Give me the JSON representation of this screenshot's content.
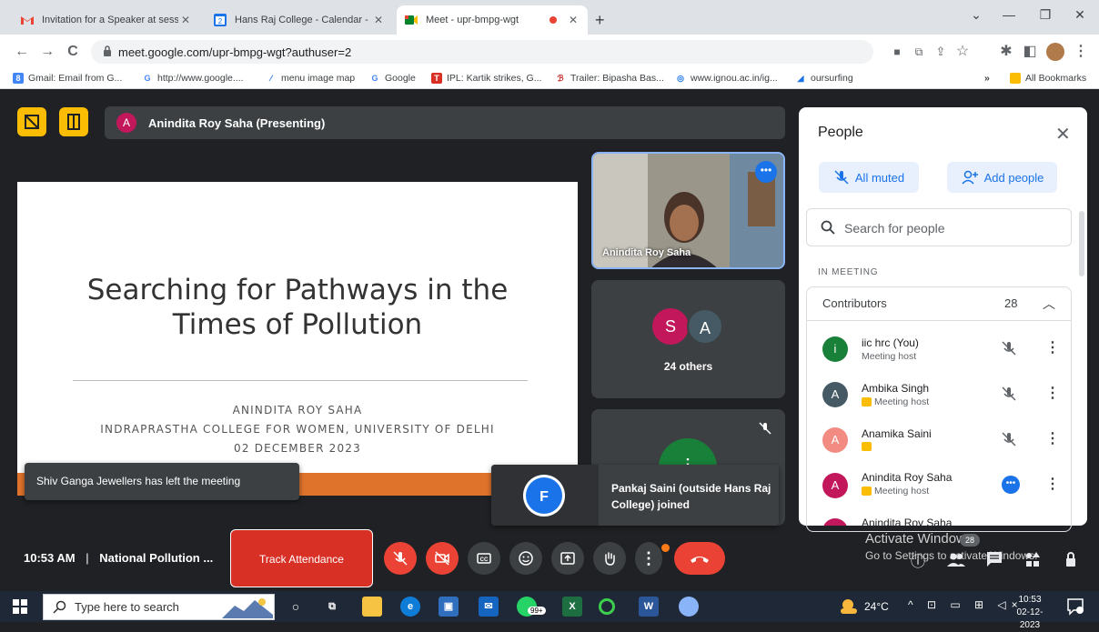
{
  "browser": {
    "tabs": [
      {
        "label": "Invitation for a Speaker at sessio",
        "icon": "gmail-icon"
      },
      {
        "label": "Hans Raj College - Calendar - Sa",
        "icon": "calendar-icon"
      },
      {
        "label": "Meet - upr-bmpg-wgt",
        "icon": "meet-icon"
      }
    ],
    "url": "meet.google.com/upr-bmpg-wgt?authuser=2",
    "bookmarks": [
      "Gmail: Email from G...",
      "http://www.google....",
      "menu image map",
      "Google",
      "IPL: Kartik strikes, G...",
      "Trailer: Bipasha Bas...",
      "www.ignou.ac.in/ig...",
      "oursurfing"
    ],
    "more_bookmarks": "»",
    "all_bookmarks": "All Bookmarks"
  },
  "meet": {
    "presenter_initial": "A",
    "presenter_label": "Anindita Roy Saha (Presenting)",
    "slide": {
      "title_line1": "Searching for Pathways in the",
      "title_line2": "Times of Pollution",
      "author": "ANINDITA ROY SAHA",
      "affiliation": "INDRAPRASTHA COLLEGE FOR WOMEN, UNIVERSITY OF DELHI",
      "date": "02 DECEMBER 2023"
    },
    "tiles": {
      "camera_name": "Anindita Roy Saha",
      "others_initials": [
        "S",
        "A"
      ],
      "others_label": "24 others",
      "tile3_initial": "i"
    },
    "toasts": {
      "left": "Shiv Ganga Jewellers has left the meeting",
      "right": "Pankaj Saini (outside Hans Raj College) joined"
    },
    "clock": "10:53 AM",
    "meeting_name": "National Pollution ...",
    "track_attendance": "Track Attendance",
    "participants_badge": "28",
    "activate_line1": "Activate Windows",
    "activate_line2": "Go to Settings to activate Windows."
  },
  "people": {
    "title": "People",
    "all_muted": "All muted",
    "add_people": "Add people",
    "search_placeholder": "Search for people",
    "in_meeting": "IN MEETING",
    "contributors_label": "Contributors",
    "contributors_count": "28",
    "list": [
      {
        "initial": "i",
        "name": "iic hrc (You)",
        "role": "Meeting host",
        "color": "#188038"
      },
      {
        "initial": "A",
        "name": "Ambika Singh",
        "role": "Meeting host",
        "color": "#455a64"
      },
      {
        "initial": "A",
        "name": "Anamika Saini",
        "role": "",
        "color": "#f28b82"
      },
      {
        "initial": "A",
        "name": "Anindita Roy Saha",
        "role": "Meeting host",
        "color": "#c2185b"
      },
      {
        "initial": "A",
        "name": "Anindita Roy Saha",
        "role": "",
        "color": "#c2185b"
      }
    ]
  },
  "taskbar": {
    "search_placeholder": "Type here to search",
    "whatsapp_badge": "99+",
    "temperature": "24°C",
    "time": "10:53",
    "date": "02-12-2023"
  },
  "colors": {
    "meet_bg": "#202124",
    "accent_blue": "#1a73e8",
    "danger_red": "#ea4335",
    "host_yellow": "#fbbc04"
  }
}
